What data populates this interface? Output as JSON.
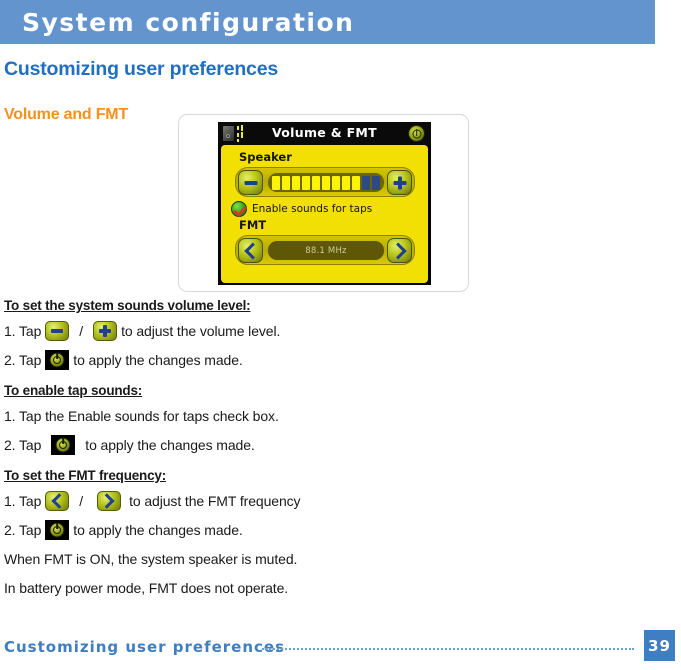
{
  "header": {
    "title": "System configuration"
  },
  "section": {
    "heading": "Customizing user preferences",
    "subheading": "Volume and FMT"
  },
  "device_screen": {
    "title": "Volume & FMT",
    "power_icon": "power-button-icon",
    "device_icon": "device-speaker-icon",
    "speaker_label": "Speaker",
    "volume": {
      "total_segments": 11,
      "filled_segments": 9,
      "minus_icon": "minus-icon",
      "plus_icon": "plus-icon"
    },
    "checkbox": {
      "label": "Enable sounds for taps",
      "checked": true,
      "icon": "checkmark-icon"
    },
    "fmt_label": "FMT",
    "fmt": {
      "frequency": "88.1 MHz",
      "prev_icon": "chevron-left-icon",
      "next_icon": "chevron-right-icon"
    }
  },
  "instructions": {
    "volume": {
      "heading": "To set the system sounds volume level:",
      "step1_prefix": "1. Tap",
      "step1_separator": "/",
      "step1_suffix": "to adjust the volume level.",
      "step2_prefix": "2. Tap",
      "step2_suffix": "to apply the changes made."
    },
    "tap_sounds": {
      "heading": "To enable tap sounds:",
      "step1": "1. Tap the Enable sounds for taps check box.",
      "step2_prefix": "2. Tap",
      "step2_suffix": "to apply the changes made."
    },
    "fmt": {
      "heading": "To set the FMT frequency:",
      "step1_prefix": "1. Tap",
      "step1_separator": "/",
      "step1_suffix": "to adjust the FMT frequency",
      "step2_prefix": "2. Tap",
      "step2_suffix": "to apply the changes made."
    },
    "notes": [
      "When FMT is ON, the system speaker is muted.",
      "In battery power mode, FMT does not operate."
    ]
  },
  "footer": {
    "text": "Customizing user preferences",
    "page": "39"
  },
  "colors": {
    "header_blue": "#6394cd",
    "heading_blue": "#1f6fc4",
    "accent_orange": "#f5911e",
    "device_yellow": "#f2e004",
    "footer_blue": "#3f7ec0"
  }
}
